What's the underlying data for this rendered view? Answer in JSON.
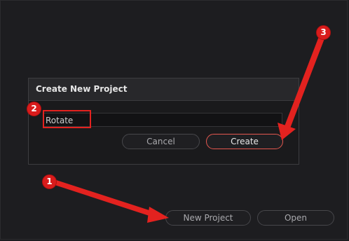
{
  "dialog": {
    "title": "Create New Project",
    "project_name_value": "Rotate",
    "cancel_label": "Cancel",
    "create_label": "Create"
  },
  "main": {
    "new_project_label": "New Project",
    "open_label": "Open"
  },
  "annotations": {
    "badge_1": "1",
    "badge_2": "2",
    "badge_3": "3",
    "color": "#e3221f"
  }
}
